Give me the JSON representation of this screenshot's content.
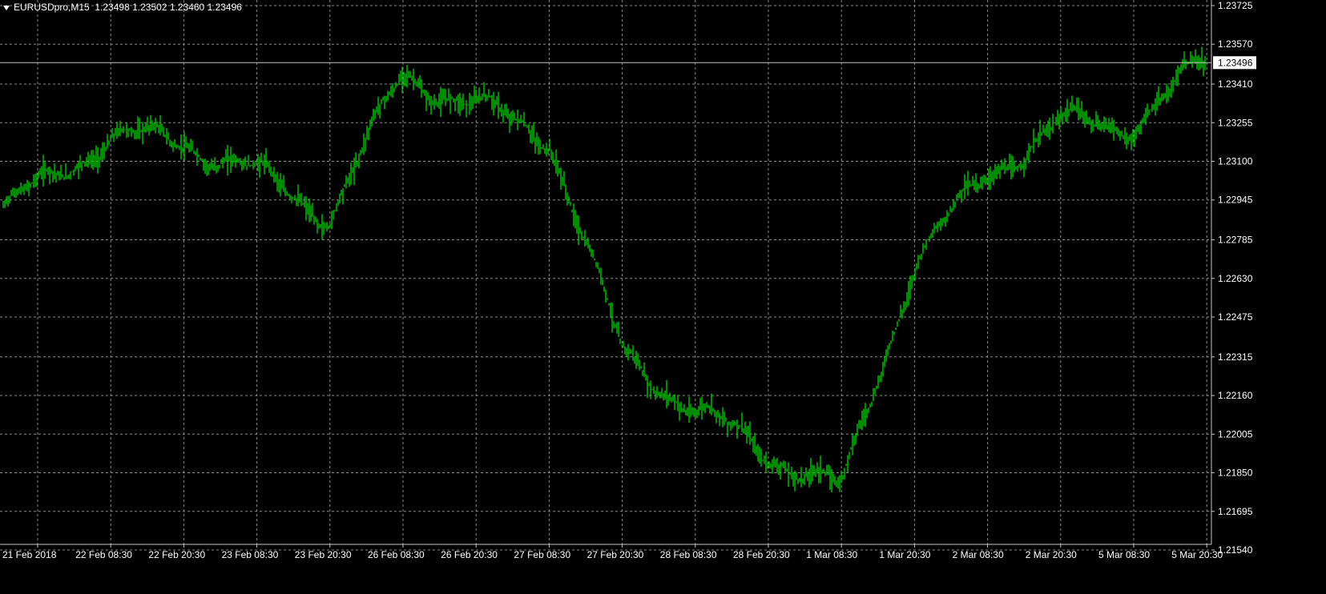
{
  "header": {
    "symbol": "EURUSDpro,M15",
    "open": "1.23498",
    "high": "1.23502",
    "low": "1.23460",
    "close": "1.23496"
  },
  "colors": {
    "background": "#000000",
    "grid": "#8a8a8a",
    "axis": "#c8c8c8",
    "bars": "#00c800",
    "bidline": "#c8c8c8",
    "text": "#ffffff"
  },
  "chart_data": {
    "type": "line",
    "symbol": "EURUSDpro",
    "timeframe": "M15",
    "grid": true,
    "ylim": [
      1.2154,
      1.23725
    ],
    "y_ticks": [
      "1.23725",
      "1.23570",
      "1.23410",
      "1.23255",
      "1.23100",
      "1.22945",
      "1.22785",
      "1.22630",
      "1.22475",
      "1.22315",
      "1.22160",
      "1.22005",
      "1.21850",
      "1.21695",
      "1.21540"
    ],
    "x_ticks": [
      "21 Feb 2018",
      "22 Feb 08:30",
      "22 Feb 20:30",
      "23 Feb 08:30",
      "23 Feb 20:30",
      "26 Feb 08:30",
      "26 Feb 20:30",
      "27 Feb 08:30",
      "27 Feb 20:30",
      "28 Feb 08:30",
      "28 Feb 20:30",
      "1 Mar 08:30",
      "1 Mar 20:30",
      "2 Mar 08:30",
      "2 Mar 20:30",
      "5 Mar 08:30",
      "5 Mar 20:30"
    ],
    "current_price": "1.23496",
    "series": [
      {
        "x": [
          "21 Feb 2018",
          "22 Feb 08:30",
          "22 Feb 20:30",
          "23 Feb 08:30",
          "23 Feb 20:30",
          "26 Feb 08:30",
          "26 Feb 20:30",
          "27 Feb 08:30",
          "27 Feb 20:30",
          "28 Feb 08:30",
          "28 Feb 20:30",
          "1 Mar 08:30",
          "1 Mar 20:30",
          "2 Mar 08:30",
          "2 Mar 20:30",
          "5 Mar 08:30",
          "5 Mar 20:30"
        ],
        "values": [
          1.229,
          1.232,
          1.2318,
          1.2305,
          1.2288,
          1.2345,
          1.2332,
          1.232,
          1.2233,
          1.221,
          1.2193,
          1.2178,
          1.227,
          1.2305,
          1.2325,
          1.2325,
          1.235
        ]
      }
    ]
  }
}
